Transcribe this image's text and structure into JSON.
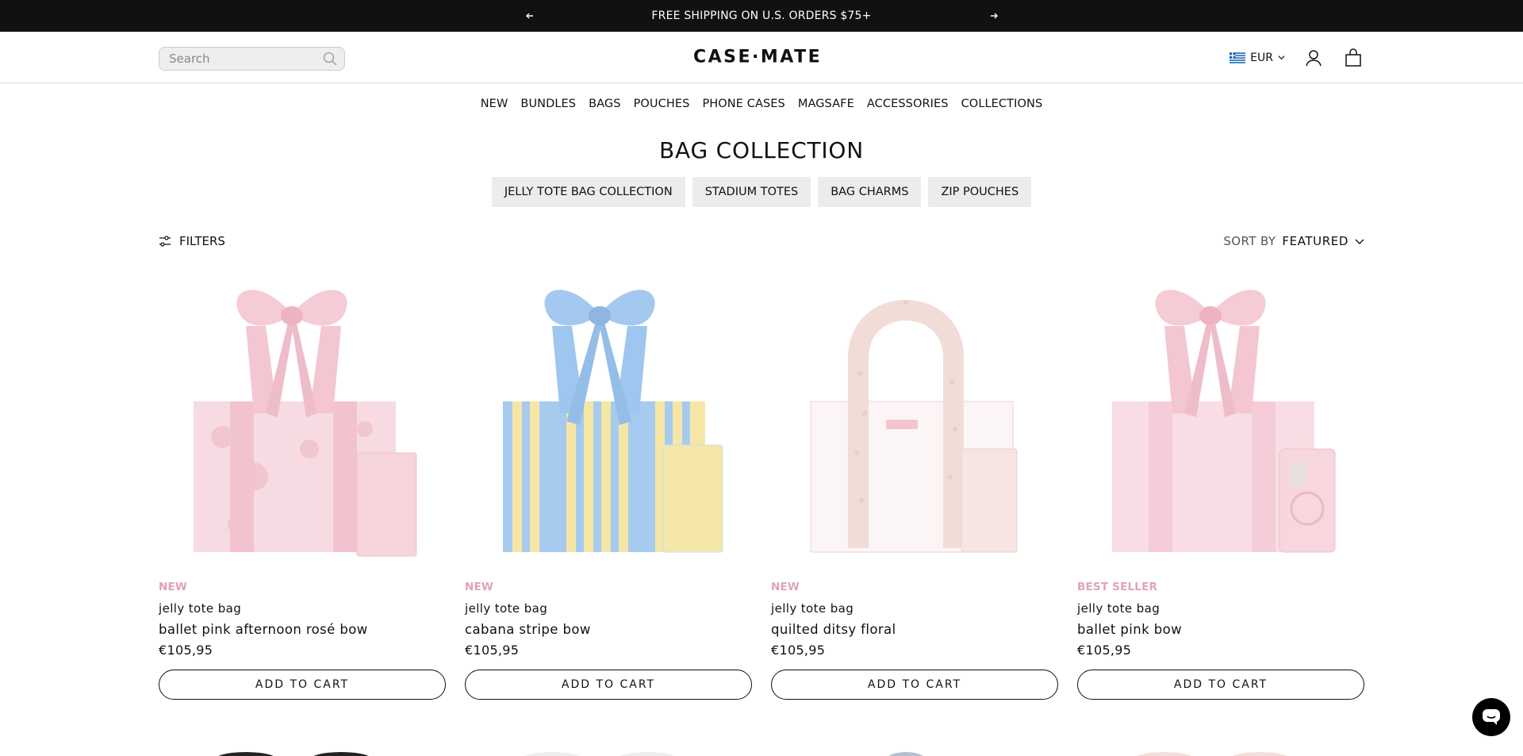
{
  "announcement": {
    "text": "FREE SHIPPING ON U.S. ORDERS $75+"
  },
  "header": {
    "search_placeholder": "Search",
    "logo": "CASE·MATE",
    "currency": "EUR"
  },
  "nav": [
    "NEW",
    "BUNDLES",
    "BAGS",
    "POUCHES",
    "PHONE CASES",
    "MAGSAFE",
    "ACCESSORIES",
    "COLLECTIONS"
  ],
  "page": {
    "title": "BAG COLLECTION",
    "chips": [
      "JELLY TOTE BAG COLLECTION",
      "STADIUM TOTES",
      "BAG CHARMS",
      "ZIP POUCHES"
    ]
  },
  "toolbar": {
    "filters_label": "FILTERS",
    "sort_label": "SORT BY",
    "sort_value": "FEATURED"
  },
  "products": [
    {
      "badge": "NEW",
      "type": "jelly tote bag",
      "name": "ballet pink afternoon rosé bow",
      "price": "€105,95",
      "button": "ADD TO CART",
      "color": "#f4c9d4"
    },
    {
      "badge": "NEW",
      "type": "jelly tote bag",
      "name": "cabana stripe bow",
      "price": "€105,95",
      "button": "ADD TO CART",
      "color": "#a9cdf0"
    },
    {
      "badge": "NEW",
      "type": "jelly tote bag",
      "name": "quilted ditsy floral",
      "price": "€105,95",
      "button": "ADD TO CART",
      "color": "#f3dfe3"
    },
    {
      "badge": "BEST SELLER",
      "type": "jelly tote bag",
      "name": "ballet pink bow",
      "price": "€105,95",
      "button": "ADD TO CART",
      "color": "#f6d1da"
    }
  ],
  "colors": {
    "badge": "#e0a3b6",
    "announcement_bg": "#111111"
  }
}
